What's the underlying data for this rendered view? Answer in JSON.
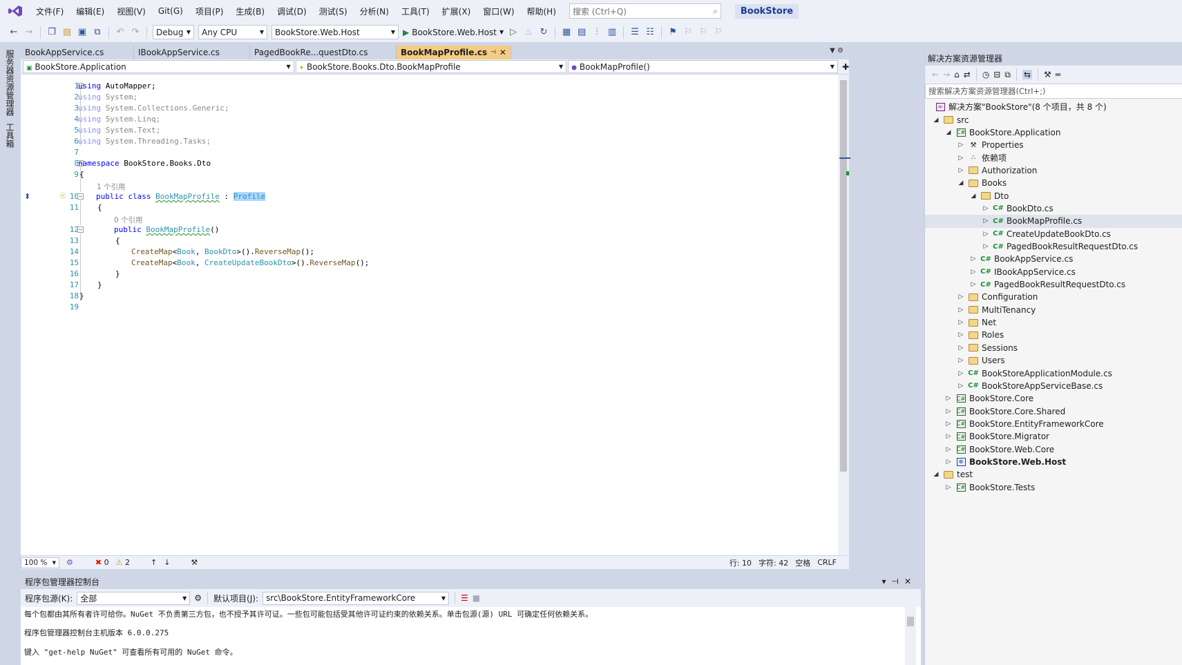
{
  "menubar": {
    "items": [
      "文件(F)",
      "编辑(E)",
      "视图(V)",
      "Git(G)",
      "项目(P)",
      "生成(B)",
      "调试(D)",
      "测试(S)",
      "分析(N)",
      "工具(T)",
      "扩展(X)",
      "窗口(W)",
      "帮助(H)"
    ],
    "search_placeholder": "搜索 (Ctrl+Q)",
    "app_name": "BookStore"
  },
  "toolbar": {
    "configuration": "Debug",
    "platform": "Any CPU",
    "startup_project": "BookStore.Web.Host",
    "run_label": "BookStore.Web.Host"
  },
  "left_strip": {
    "tab1": "服务器资源管理器",
    "tab2": "工具箱"
  },
  "doc_tabs": [
    "BookAppService.cs",
    "IBookAppService.cs",
    "PagedBookRe...questDto.cs",
    "BookMapProfile.cs"
  ],
  "navbar": {
    "project": "BookStore.Application",
    "type": "BookStore.Books.Dto.BookMapProfile",
    "member": "BookMapProfile()"
  },
  "code": {
    "line_numbers": [
      "1",
      "2",
      "3",
      "4",
      "5",
      "6",
      "7",
      "8",
      "9",
      "10",
      "11",
      "12",
      "13",
      "14",
      "15",
      "16",
      "17",
      "18",
      "19"
    ],
    "using_kw": "using",
    "u1": "AutoMapper;",
    "u2": "System;",
    "u3": "System.Collections.Generic;",
    "u4": "System.Linq;",
    "u5": "System.Text;",
    "u6": "System.Threading.Tasks;",
    "namespace_kw": "namespace",
    "namespace_name": "BookStore.Books.Dto",
    "open_brace": "{",
    "close_brace": "}",
    "refs_class": "1 个引用",
    "refs_ctor": "0 个引用",
    "public_kw": "public",
    "class_kw": "class",
    "class_name": "BookMapProfile",
    "colon": " : ",
    "base_class": "Profile",
    "ctor_name": "BookMapProfile",
    "ctor_parens": "()",
    "createmap": "CreateMap",
    "lt": "<",
    "book": "Book",
    "comma": ", ",
    "bookdto": "BookDto",
    "createdto": "CreateUpdateBookDto",
    "gt_call": ">().",
    "reversemap": "ReverseMap",
    "end_call": "();"
  },
  "editor_status": {
    "zoom": "100 %",
    "errors": "0",
    "warnings": "2",
    "line": "行: 10",
    "char": "字符: 42",
    "whitespace": "空格",
    "eol": "CRLF"
  },
  "pmc": {
    "title": "程序包管理器控制台",
    "source_label": "程序包源(K):",
    "source_value": "全部",
    "default_project_label": "默认项目(J):",
    "default_project_value": "src\\BookStore.EntityFrameworkCore",
    "line1": "每个包都由其所有者许可给你。NuGet 不负责第三方包，也不授予其许可证。一些包可能包括受其他许可证约束的依赖关系。单击包源(源) URL 可确定任何依赖关系。",
    "line2": "程序包管理器控制台主机版本 6.0.0.275",
    "line3": "键入 \"get-help NuGet\" 可查看所有可用的 NuGet 命令。"
  },
  "solution_explorer": {
    "title": "解决方案资源管理器",
    "search_placeholder": "搜索解决方案资源管理器(Ctrl+;)",
    "solution": "解决方案\"BookStore\"(8 个项目，共 8 个)",
    "tree": [
      {
        "label": "src",
        "kind": "folder",
        "expander": "open"
      },
      {
        "label": "BookStore.Application",
        "kind": "project",
        "expander": "open"
      },
      {
        "label": "Properties",
        "kind": "props",
        "expander": "closed"
      },
      {
        "label": "依赖项",
        "kind": "deps",
        "expander": "closed"
      },
      {
        "label": "Authorization",
        "kind": "folder",
        "expander": "closed"
      },
      {
        "label": "Books",
        "kind": "folder",
        "expander": "open"
      },
      {
        "label": "Dto",
        "kind": "folder",
        "expander": "open"
      },
      {
        "label": "BookDto.cs",
        "kind": "cs",
        "expander": "closed"
      },
      {
        "label": "BookMapProfile.cs",
        "kind": "cs",
        "expander": "closed",
        "selected": true
      },
      {
        "label": "CreateUpdateBookDto.cs",
        "kind": "cs",
        "expander": "closed"
      },
      {
        "label": "PagedBookResultRequestDto.cs",
        "kind": "cs",
        "expander": "closed"
      },
      {
        "label": "BookAppService.cs",
        "kind": "cs",
        "expander": "closed"
      },
      {
        "label": "IBookAppService.cs",
        "kind": "cs",
        "expander": "closed"
      },
      {
        "label": "PagedBookResultRequestDto.cs",
        "kind": "cs",
        "expander": "closed"
      },
      {
        "label": "Configuration",
        "kind": "folder",
        "expander": "closed"
      },
      {
        "label": "MultiTenancy",
        "kind": "folder",
        "expander": "closed"
      },
      {
        "label": "Net",
        "kind": "folder",
        "expander": "closed"
      },
      {
        "label": "Roles",
        "kind": "folder",
        "expander": "closed"
      },
      {
        "label": "Sessions",
        "kind": "folder",
        "expander": "closed"
      },
      {
        "label": "Users",
        "kind": "folder",
        "expander": "closed"
      },
      {
        "label": "BookStoreApplicationModule.cs",
        "kind": "cs",
        "expander": "closed"
      },
      {
        "label": "BookStoreAppServiceBase.cs",
        "kind": "cs",
        "expander": "closed"
      },
      {
        "label": "BookStore.Core",
        "kind": "project",
        "expander": "closed"
      },
      {
        "label": "BookStore.Core.Shared",
        "kind": "project",
        "expander": "closed"
      },
      {
        "label": "BookStore.EntityFrameworkCore",
        "kind": "project",
        "expander": "closed"
      },
      {
        "label": "BookStore.Migrator",
        "kind": "project",
        "expander": "closed"
      },
      {
        "label": "BookStore.Web.Core",
        "kind": "project",
        "expander": "closed"
      },
      {
        "label": "BookStore.Web.Host",
        "kind": "webproject",
        "expander": "closed",
        "bold": true
      },
      {
        "label": "test",
        "kind": "folder",
        "expander": "open"
      },
      {
        "label": "BookStore.Tests",
        "kind": "testproject",
        "expander": "closed"
      }
    ]
  }
}
